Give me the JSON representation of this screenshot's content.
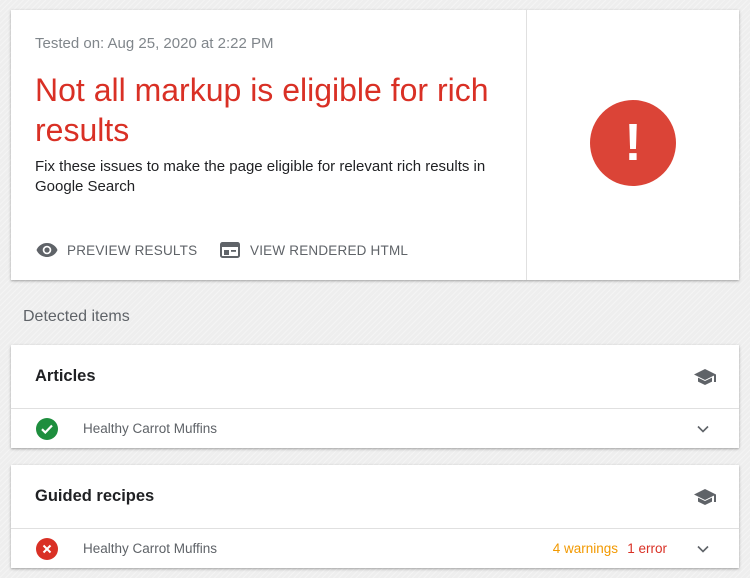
{
  "summary": {
    "tested_on": "Tested on: Aug 25, 2020 at 2:22 PM",
    "headline": "Not all markup is eligible for rich results",
    "description": "Fix these issues to make the page eligible for relevant rich results in Google Search",
    "preview_label": "PREVIEW RESULTS",
    "view_html_label": "VIEW RENDERED HTML",
    "alert_symbol": "!",
    "status_color": "#db4437"
  },
  "detected": {
    "label": "Detected items",
    "categories": [
      {
        "title": "Articles",
        "items": [
          {
            "name": "Healthy Carrot Muffins",
            "status": "valid",
            "warnings": "",
            "errors": ""
          }
        ]
      },
      {
        "title": "Guided recipes",
        "items": [
          {
            "name": "Healthy Carrot Muffins",
            "status": "invalid",
            "warnings": "4 warnings",
            "errors": "1 error"
          }
        ]
      }
    ]
  },
  "icons": {
    "preview": "eye-icon",
    "view_html": "browser-window-icon",
    "category": "graduation-cap-icon",
    "valid": "check-circle-icon",
    "invalid": "error-circle-icon",
    "expand": "chevron-down-icon"
  },
  "colors": {
    "error": "#d93025",
    "warning": "#f29900",
    "success": "#1e8e3e"
  }
}
